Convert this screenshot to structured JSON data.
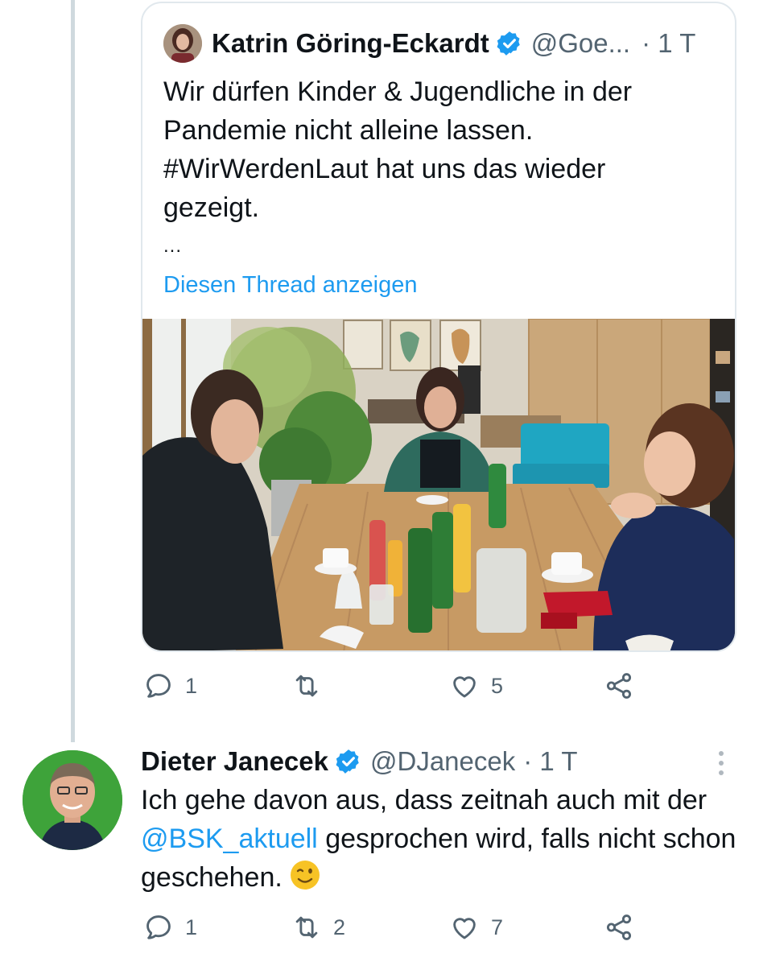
{
  "quoted": {
    "name": "Katrin Göring-Eckardt",
    "handle": "@Goe...",
    "time": "· 1 T",
    "text_lines": [
      "Wir dürfen Kinder & Jugendliche in der",
      "Pandemie nicht alleine lassen.",
      "#WirWerdenLaut hat uns das wieder",
      "gezeigt."
    ],
    "ellipsis": "...",
    "show_thread": "Diesen Thread anzeigen",
    "actions": {
      "replies": "1",
      "retweets": "",
      "likes": "5"
    }
  },
  "reply": {
    "name": "Dieter Janecek",
    "handle": "@DJanecek",
    "time": "· 1 T",
    "text_part1": "Ich gehe davon aus, dass zeitnah auch mit der ",
    "mention": "@BSK_aktuell",
    "text_part2": " gesprochen wird, falls nicht schon geschehen.",
    "emoji": "winking-face",
    "actions": {
      "replies": "1",
      "retweets": "2",
      "likes": "7"
    }
  },
  "colors": {
    "link": "#1d9bf0",
    "secondary": "#536471",
    "verified": "#1d9bf0",
    "avatar_background": "#3ea33a"
  },
  "icons": [
    "reply-icon",
    "retweet-icon",
    "like-icon",
    "share-icon",
    "verified-badge-icon",
    "more-options-icon"
  ]
}
